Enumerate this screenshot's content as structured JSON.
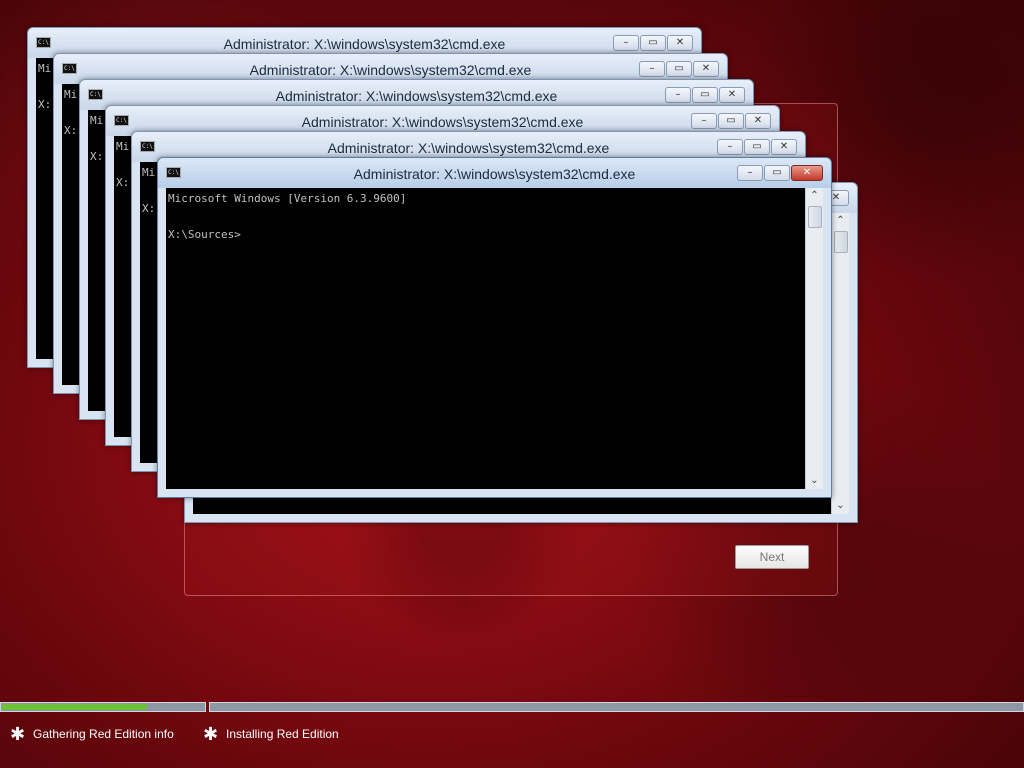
{
  "setup": {
    "next_label": "Next"
  },
  "cmd_windows": [
    {
      "title": "Administrator: X:\\windows\\system32\\cmd.exe",
      "peek_line1": "Mi",
      "peek_line2": "X:"
    },
    {
      "title": "Administrator: X:\\windows\\system32\\cmd.exe",
      "peek_line1": "Mi",
      "peek_line2": "X:"
    },
    {
      "title": "Administrator: X:\\windows\\system32\\cmd.exe",
      "peek_line1": "Mi",
      "peek_line2": "X:"
    },
    {
      "title": "Administrator: X:\\windows\\system32\\cmd.exe",
      "peek_line1": "Mi",
      "peek_line2": "X:"
    },
    {
      "title": "Administrator: X:\\windows\\system32\\cmd.exe",
      "peek_line1": "Mi",
      "peek_line2": "X:"
    }
  ],
  "active_cmd": {
    "title": "Administrator: X:\\windows\\system32\\cmd.exe",
    "line1": "Microsoft Windows [Version 6.3.9600]",
    "line2": "",
    "line3": "X:\\Sources>"
  },
  "icons": {
    "minimize": "minimize-icon",
    "maximize": "maximize-icon",
    "close": "close-icon",
    "step": "asterisk-icon"
  },
  "progress": {
    "step1_fraction": 0.72,
    "fill_color": "#6fc13a"
  },
  "status": {
    "step1_label": "Gathering Red Edition info",
    "step2_label": "Installing Red Edition"
  },
  "colors": {
    "desktop_red": "#8e0c14",
    "titlebar": "#d8e4f2",
    "close_button": "#c4372a"
  }
}
